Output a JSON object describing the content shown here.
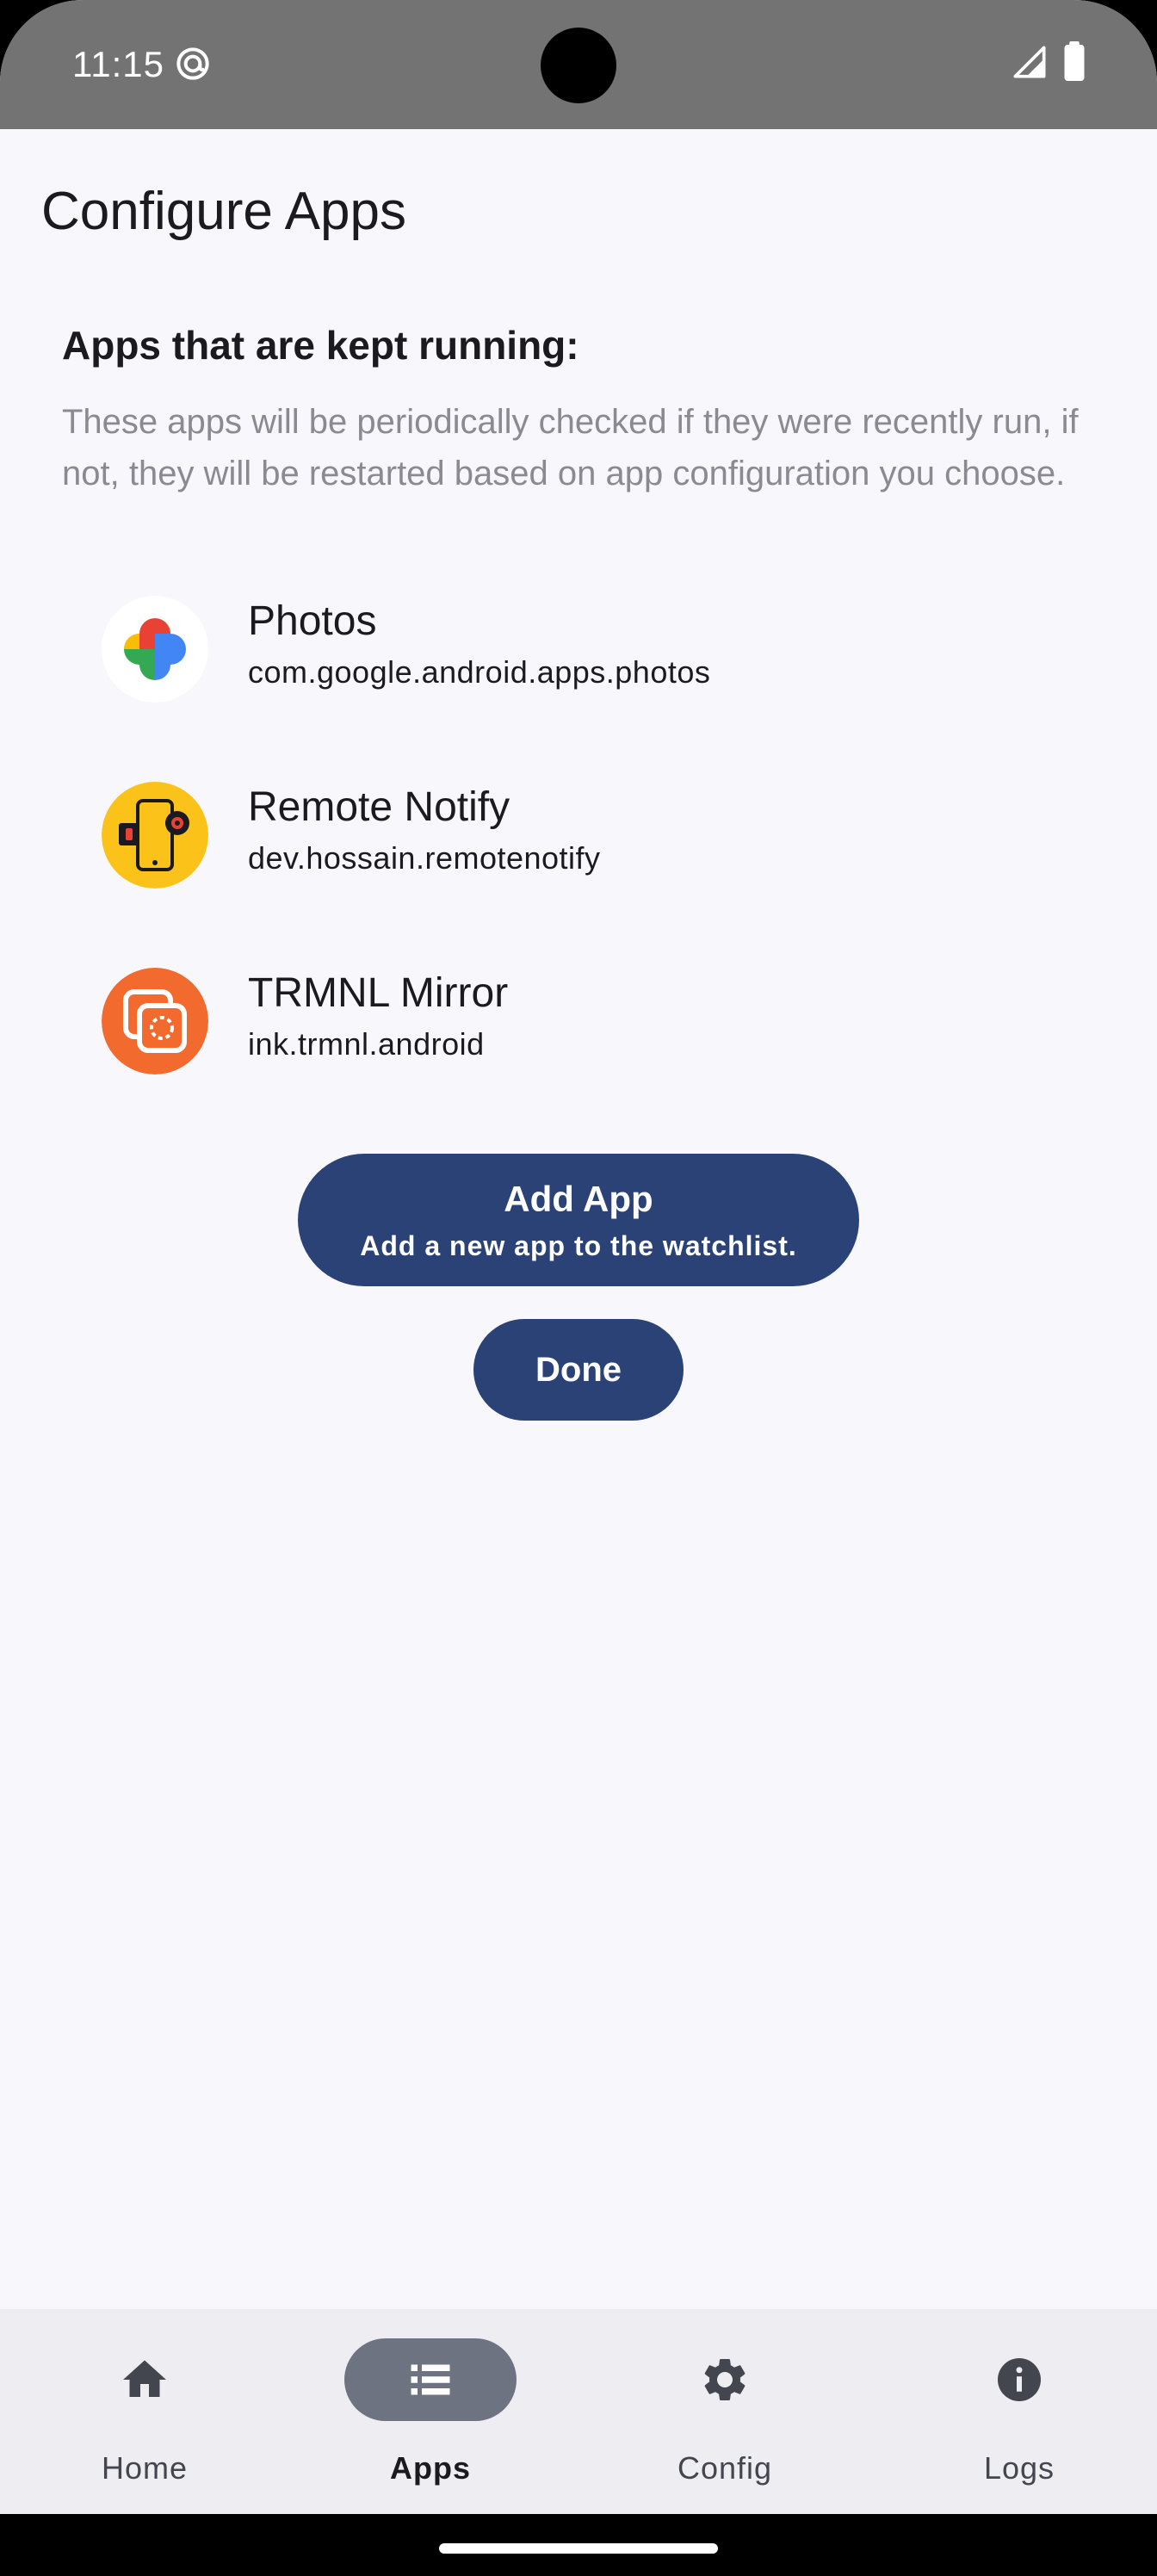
{
  "status_bar": {
    "time": "11:15"
  },
  "page": {
    "title": "Configure Apps"
  },
  "section": {
    "heading": "Apps that are kept running:",
    "description": "These apps will be periodically checked if they were recently run, if not, they will be restarted based on app configuration you choose."
  },
  "apps": [
    {
      "name": "Photos",
      "package": "com.google.android.apps.photos",
      "icon": "google-photos-icon"
    },
    {
      "name": "Remote Notify",
      "package": "dev.hossain.remotenotify",
      "icon": "remote-notify-icon"
    },
    {
      "name": "TRMNL Mirror",
      "package": "ink.trmnl.android",
      "icon": "trmnl-mirror-icon"
    }
  ],
  "buttons": {
    "add_app_label": "Add App",
    "add_app_sub": "Add a new app to the watchlist.",
    "done_label": "Done"
  },
  "bottom_nav": {
    "items": [
      {
        "label": "Home",
        "icon": "home-icon",
        "active": false
      },
      {
        "label": "Apps",
        "icon": "list-icon",
        "active": true
      },
      {
        "label": "Config",
        "icon": "gear-icon",
        "active": false
      },
      {
        "label": "Logs",
        "icon": "info-icon",
        "active": false
      }
    ]
  },
  "colors": {
    "primary": "#2a4275",
    "background": "#f8f7fc",
    "status_bar": "#737373",
    "nav_background": "#ededf2",
    "nav_active_pill": "#6e7382"
  }
}
